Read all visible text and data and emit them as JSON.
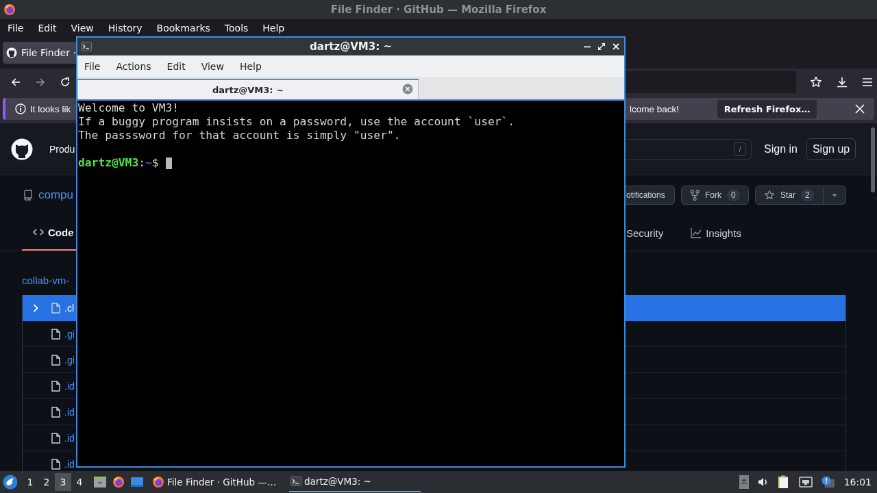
{
  "firefox": {
    "title": "File Finder · GitHub — Mozilla Firefox",
    "menu": [
      "File",
      "Edit",
      "View",
      "History",
      "Bookmarks",
      "Tools",
      "Help"
    ],
    "tab": {
      "title": "File Finder ·"
    },
    "notification": {
      "text_start": "It looks lik",
      "text_end": "lcome back!",
      "button": "Refresh Firefox…"
    }
  },
  "github": {
    "nav_item": "Produ",
    "search_key": "/",
    "sign_in": "Sign in",
    "sign_up": "Sign up",
    "repo_name": "compu",
    "notifications_button": "otifications",
    "fork": {
      "label": "Fork",
      "count": "0"
    },
    "star": {
      "label": "Star",
      "count": "2"
    },
    "tabs": [
      {
        "label": "Code",
        "kind": "code",
        "selected": true
      },
      {
        "label": "Security",
        "kind": "plain",
        "selected": false
      },
      {
        "label": "Insights",
        "kind": "graph",
        "selected": false
      }
    ],
    "breadcrumb": "collab-vm-",
    "files": [
      {
        "name": ".cl",
        "expandable": true,
        "selected": true
      },
      {
        "name": ".gi",
        "expandable": false,
        "selected": false
      },
      {
        "name": ".gi",
        "expandable": false,
        "selected": false
      },
      {
        "name": ".id",
        "expandable": false,
        "selected": false
      },
      {
        "name": ".id",
        "expandable": false,
        "selected": false
      },
      {
        "name": ".id",
        "expandable": false,
        "selected": false
      },
      {
        "name": ".id",
        "expandable": false,
        "selected": false
      }
    ]
  },
  "terminal": {
    "title": "dartz@VM3: ~",
    "menu": [
      "File",
      "Actions",
      "Edit",
      "View",
      "Help"
    ],
    "tab": {
      "title": "dartz@VM3: ~"
    },
    "lines": [
      "Welcome to VM3!",
      "If a buggy program insists on a password, use the account `user`.",
      "The passsword for that account is simply \"user\"."
    ],
    "prompt": {
      "user_host": "dartz@VM3",
      "separator": ":",
      "path": "~",
      "symbol": "$"
    }
  },
  "taskbar": {
    "workspaces": [
      {
        "label": "1",
        "selected": false
      },
      {
        "label": "2",
        "selected": false
      },
      {
        "label": "3",
        "selected": true
      },
      {
        "label": "4",
        "selected": false
      }
    ],
    "tasks": [
      {
        "title": "File Finder · GitHub —…",
        "kind": "browser",
        "active": false
      },
      {
        "title": "dartz@VM3: ~",
        "kind": "terminal",
        "active": true
      }
    ],
    "clock": "16:01"
  }
}
